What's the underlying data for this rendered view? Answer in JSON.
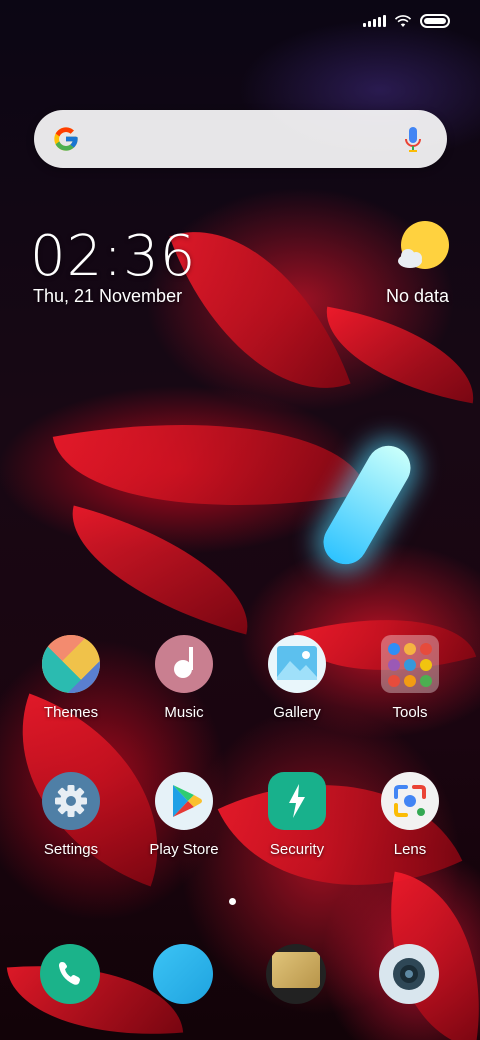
{
  "status_bar": {
    "icons": [
      "signal-icon",
      "wifi-icon",
      "battery-icon"
    ]
  },
  "search": {
    "google_icon": "google-g-icon",
    "mic_icon": "microphone-icon"
  },
  "clock_widget": {
    "time": "02:36",
    "date": "Thu, 21 November"
  },
  "weather_widget": {
    "icon": "partly-cloudy-icon",
    "text": "No data"
  },
  "apps_row1": [
    {
      "label": "Themes",
      "icon": "themes-icon"
    },
    {
      "label": "Music",
      "icon": "music-icon"
    },
    {
      "label": "Gallery",
      "icon": "gallery-icon"
    },
    {
      "label": "Tools",
      "icon": "folder-icon"
    }
  ],
  "apps_row2": [
    {
      "label": "Settings",
      "icon": "gear-icon"
    },
    {
      "label": "Play Store",
      "icon": "play-store-icon"
    },
    {
      "label": "Security",
      "icon": "security-shield-icon"
    },
    {
      "label": "Lens",
      "icon": "lens-icon"
    }
  ],
  "dock": [
    {
      "icon": "phone-icon",
      "color": "#1bb38a"
    },
    {
      "icon": "messages-icon",
      "color": "#29b6f0"
    },
    {
      "icon": "browser-icon",
      "color": "#c9a95c"
    },
    {
      "icon": "camera-icon",
      "color": "#d9e6ee"
    }
  ],
  "pager": {
    "current_page": 1
  }
}
